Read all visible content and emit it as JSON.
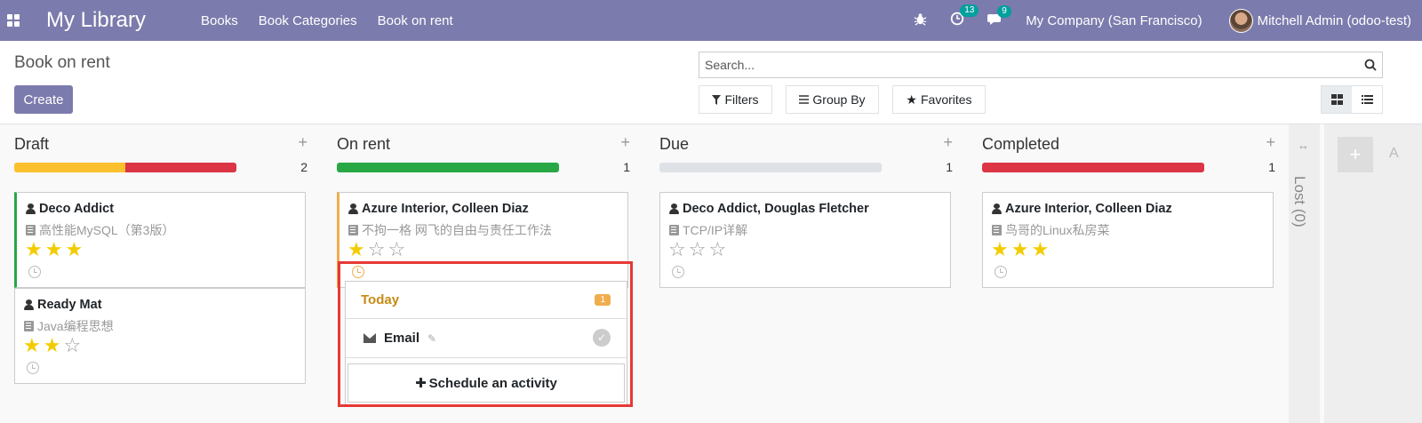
{
  "navbar": {
    "brand": "My Library",
    "menu": [
      "Books",
      "Book Categories",
      "Book on rent"
    ],
    "activity_count": "13",
    "message_count": "9",
    "company": "My Company (San Francisco)",
    "user": "Mitchell Admin (odoo-test)",
    "bg_color": "#7c7bad"
  },
  "control": {
    "title": "Book on rent",
    "create_label": "Create",
    "search_placeholder": "Search...",
    "filters_label": "Filters",
    "groupby_label": "Group By",
    "favorites_label": "Favorites"
  },
  "columns": [
    {
      "title": "Draft",
      "count": "2",
      "cards": [
        {
          "name": "Deco Addict",
          "book": "高性能MySQL（第3版）",
          "stars": 3
        },
        {
          "name": "Ready Mat",
          "book": "Java编程思想",
          "stars": 2
        }
      ]
    },
    {
      "title": "On rent",
      "count": "1",
      "cards": [
        {
          "name": "Azure Interior, Colleen Diaz",
          "book": "不拘一格 网飞的自由与责任工作法",
          "stars": 1
        }
      ]
    },
    {
      "title": "Due",
      "count": "1",
      "cards": [
        {
          "name": "Deco Addict, Douglas Fletcher",
          "book": "TCP/IP详解",
          "stars": 0
        }
      ]
    },
    {
      "title": "Completed",
      "count": "1",
      "cards": [
        {
          "name": "Azure Interior, Colleen Diaz",
          "book": "鸟哥的Linux私房菜",
          "stars": 3
        }
      ]
    }
  ],
  "activity_popup": {
    "today_label": "Today",
    "today_count": "1",
    "activity_label": "Email",
    "schedule_label": "Schedule an activity"
  },
  "lost_column": {
    "label": "Lost (0)"
  },
  "add_column": {
    "hint": "A"
  }
}
